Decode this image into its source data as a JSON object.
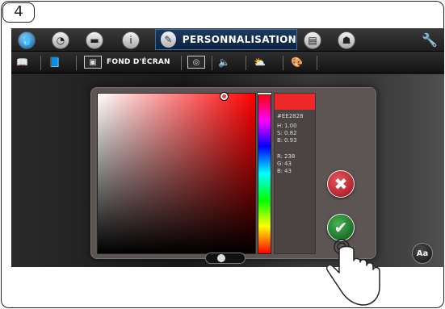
{
  "step": {
    "number": "4"
  },
  "topbar": {
    "icons": [
      "water-drop-icon",
      "clock-icon",
      "folder-icon",
      "info-icon"
    ],
    "active_tab": {
      "label": "PERSONNALISATION",
      "icon": "pencil-icon"
    },
    "after_icons": [
      "screen-icon",
      "user-icon"
    ],
    "settings_icon": "wrench-icon"
  },
  "subbar": {
    "items": [
      "book-icon",
      "manual-icon",
      "wallpaper-icon",
      "screensaver-icon",
      "volume-icon",
      "weather-icon",
      "palette-icon"
    ],
    "active_label": "FOND D'ÉCRAN"
  },
  "color_picker": {
    "hex": "#EE2828",
    "swatch_color": "#ee2828",
    "hsb": [
      {
        "label": "H:",
        "value": "1.00"
      },
      {
        "label": "S:",
        "value": "0.82"
      },
      {
        "label": "B:",
        "value": "0.93"
      }
    ],
    "rgb": [
      {
        "label": "R:",
        "value": "238"
      },
      {
        "label": "G:",
        "value": "43"
      },
      {
        "label": "B:",
        "value": "43"
      }
    ]
  },
  "actions": {
    "cancel_icon": "close-icon",
    "confirm_icon": "check-icon"
  },
  "font_button": {
    "label": "Aa"
  }
}
